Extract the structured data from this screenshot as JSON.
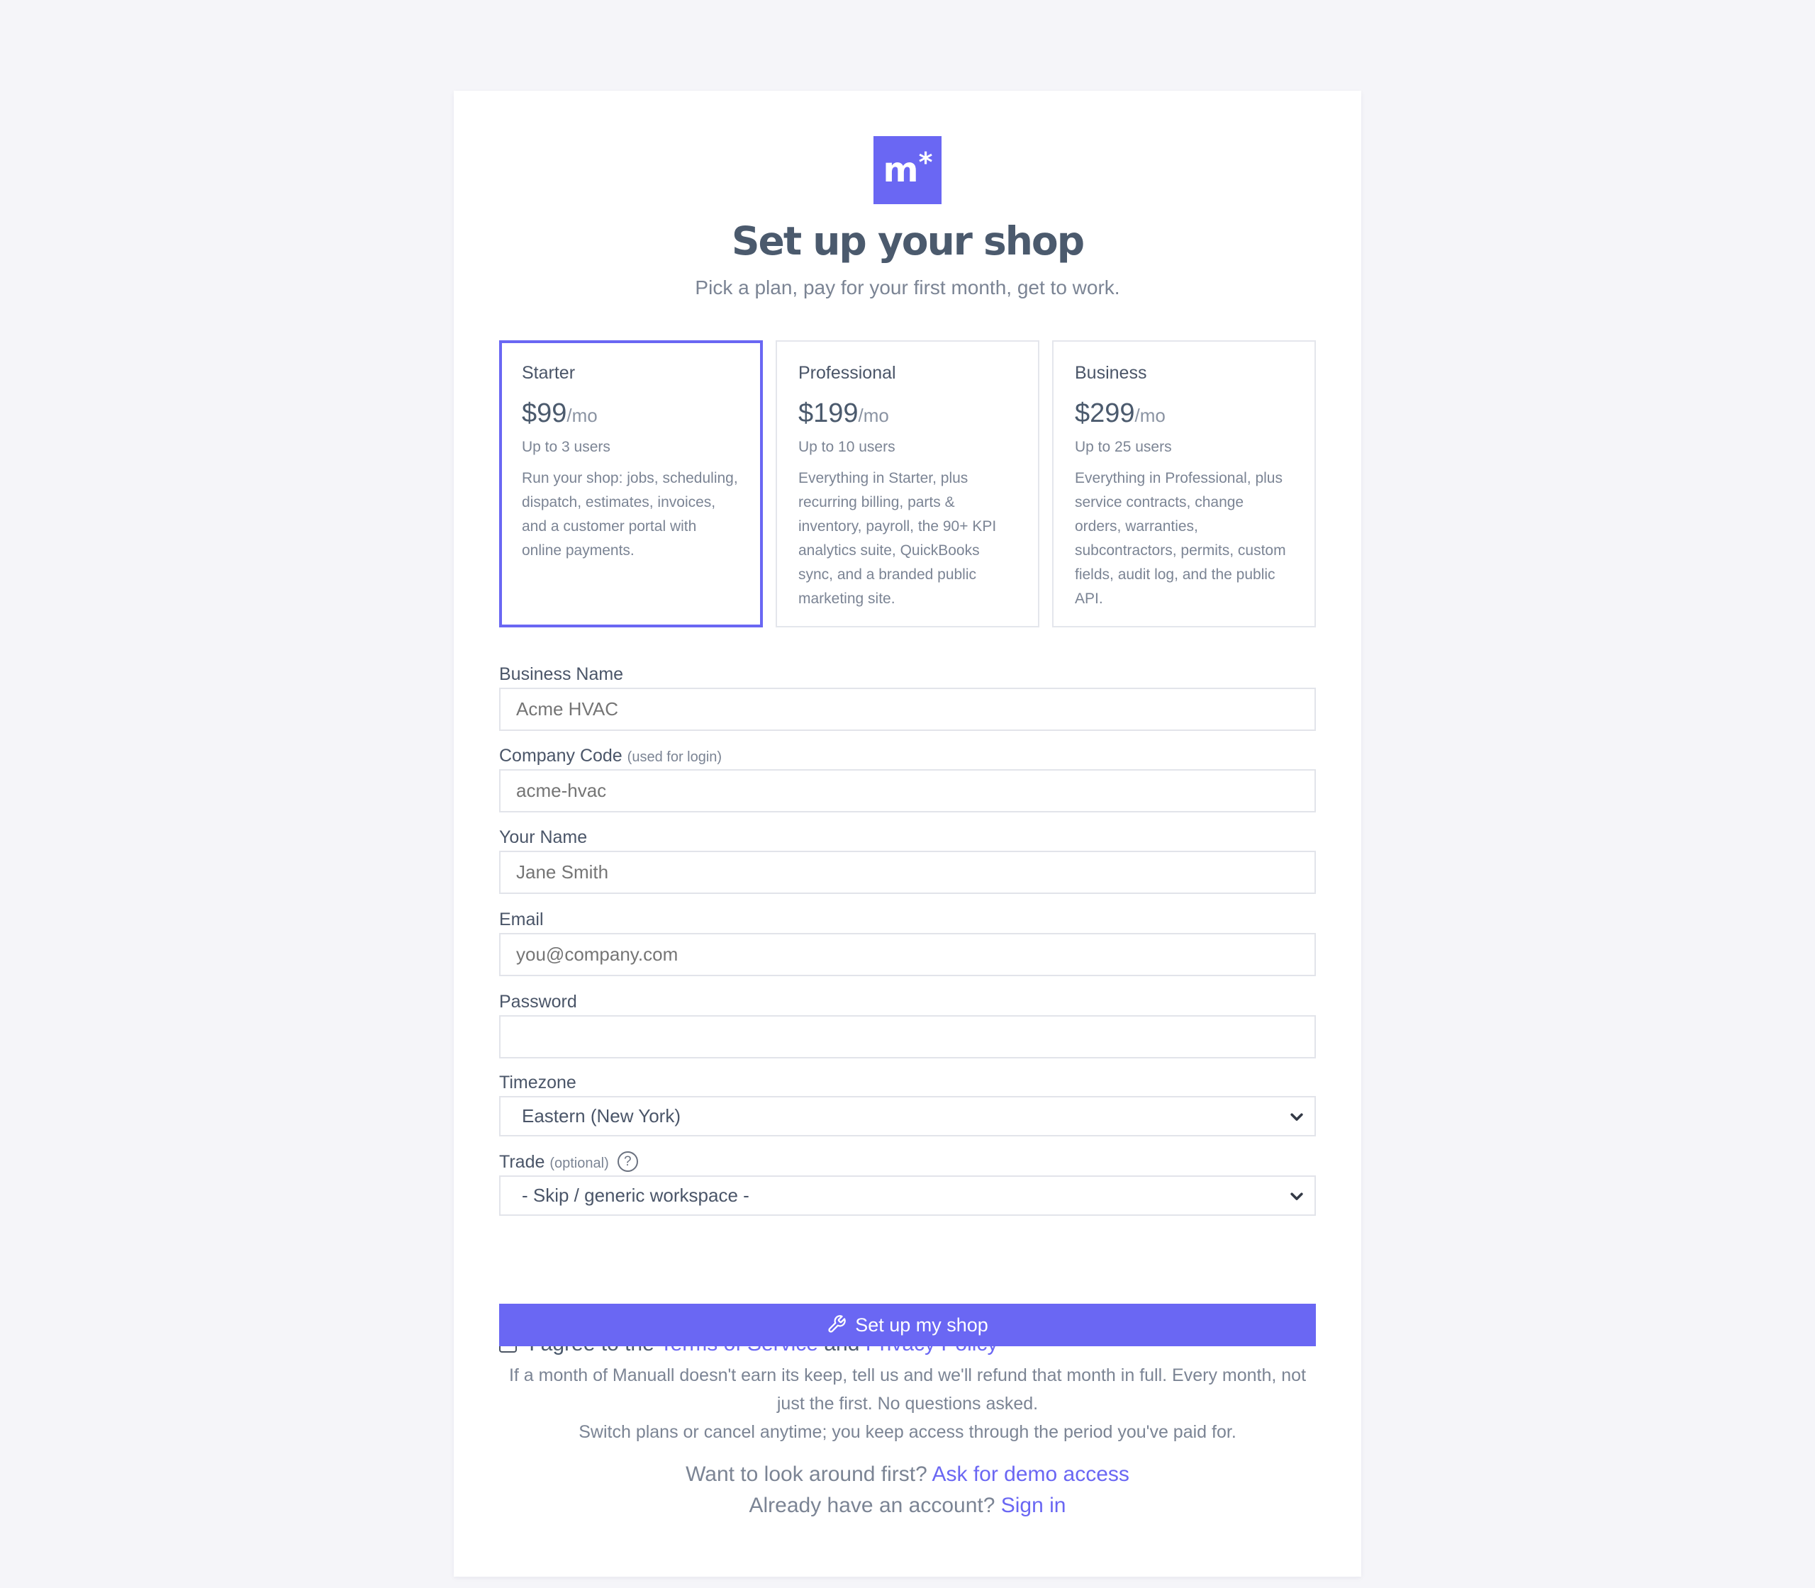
{
  "brand": {
    "logo_letter": "m",
    "logo_mark": "*",
    "accent_color": "#6a67f3"
  },
  "header": {
    "title": "Set up your shop",
    "subtitle": "Pick a plan, pay for your first month, get to work."
  },
  "plans": [
    {
      "name": "Starter",
      "price": "$99",
      "period": "/mo",
      "users": "Up to 3 users",
      "description": "Run your shop: jobs, scheduling, dispatch, estimates, invoices, and a customer portal with online payments.",
      "selected": true
    },
    {
      "name": "Professional",
      "price": "$199",
      "period": "/mo",
      "users": "Up to 10 users",
      "description": "Everything in Starter, plus recurring billing, parts & inventory, payroll, the 90+ KPI analytics suite, QuickBooks sync, and a branded public marketing site.",
      "selected": false
    },
    {
      "name": "Business",
      "price": "$299",
      "period": "/mo",
      "users": "Up to 25 users",
      "description": "Everything in Professional, plus service contracts, change orders, warranties, subcontractors, permits, custom fields, audit log, and the public API.",
      "selected": false
    }
  ],
  "form": {
    "business_name": {
      "label": "Business Name",
      "placeholder": "Acme HVAC",
      "value": ""
    },
    "company_code": {
      "label": "Company Code",
      "hint": "(used for login)",
      "placeholder": "acme-hvac",
      "value": ""
    },
    "your_name": {
      "label": "Your Name",
      "placeholder": "Jane Smith",
      "value": ""
    },
    "email": {
      "label": "Email",
      "placeholder": "you@company.com",
      "value": ""
    },
    "password": {
      "label": "Password",
      "placeholder": "",
      "value": ""
    },
    "timezone": {
      "label": "Timezone",
      "selected": "Eastern (New York)"
    },
    "trade": {
      "label": "Trade",
      "hint": "(optional)",
      "help_icon": "question-circle-icon",
      "selected": "- Skip / generic workspace -"
    }
  },
  "agreement": {
    "prefix": "I agree to the",
    "terms_link": "Terms of Service",
    "conjunction": "and",
    "privacy_link": "Privacy Policy",
    "checked": false
  },
  "submit": {
    "label": "Set up my shop",
    "icon": "wrench-icon"
  },
  "fine_print": {
    "refund": "If a month of Manuall doesn't earn its keep, tell us and we'll refund that month in full. Every month, not just the first. No questions asked.",
    "cancel": "Switch plans or cancel anytime; you keep access through the period you've paid for."
  },
  "footer": {
    "demo_prefix": "Want to look around first?",
    "demo_link": "Ask for demo access",
    "signin_prefix": "Already have an account?",
    "signin_link": "Sign in"
  }
}
